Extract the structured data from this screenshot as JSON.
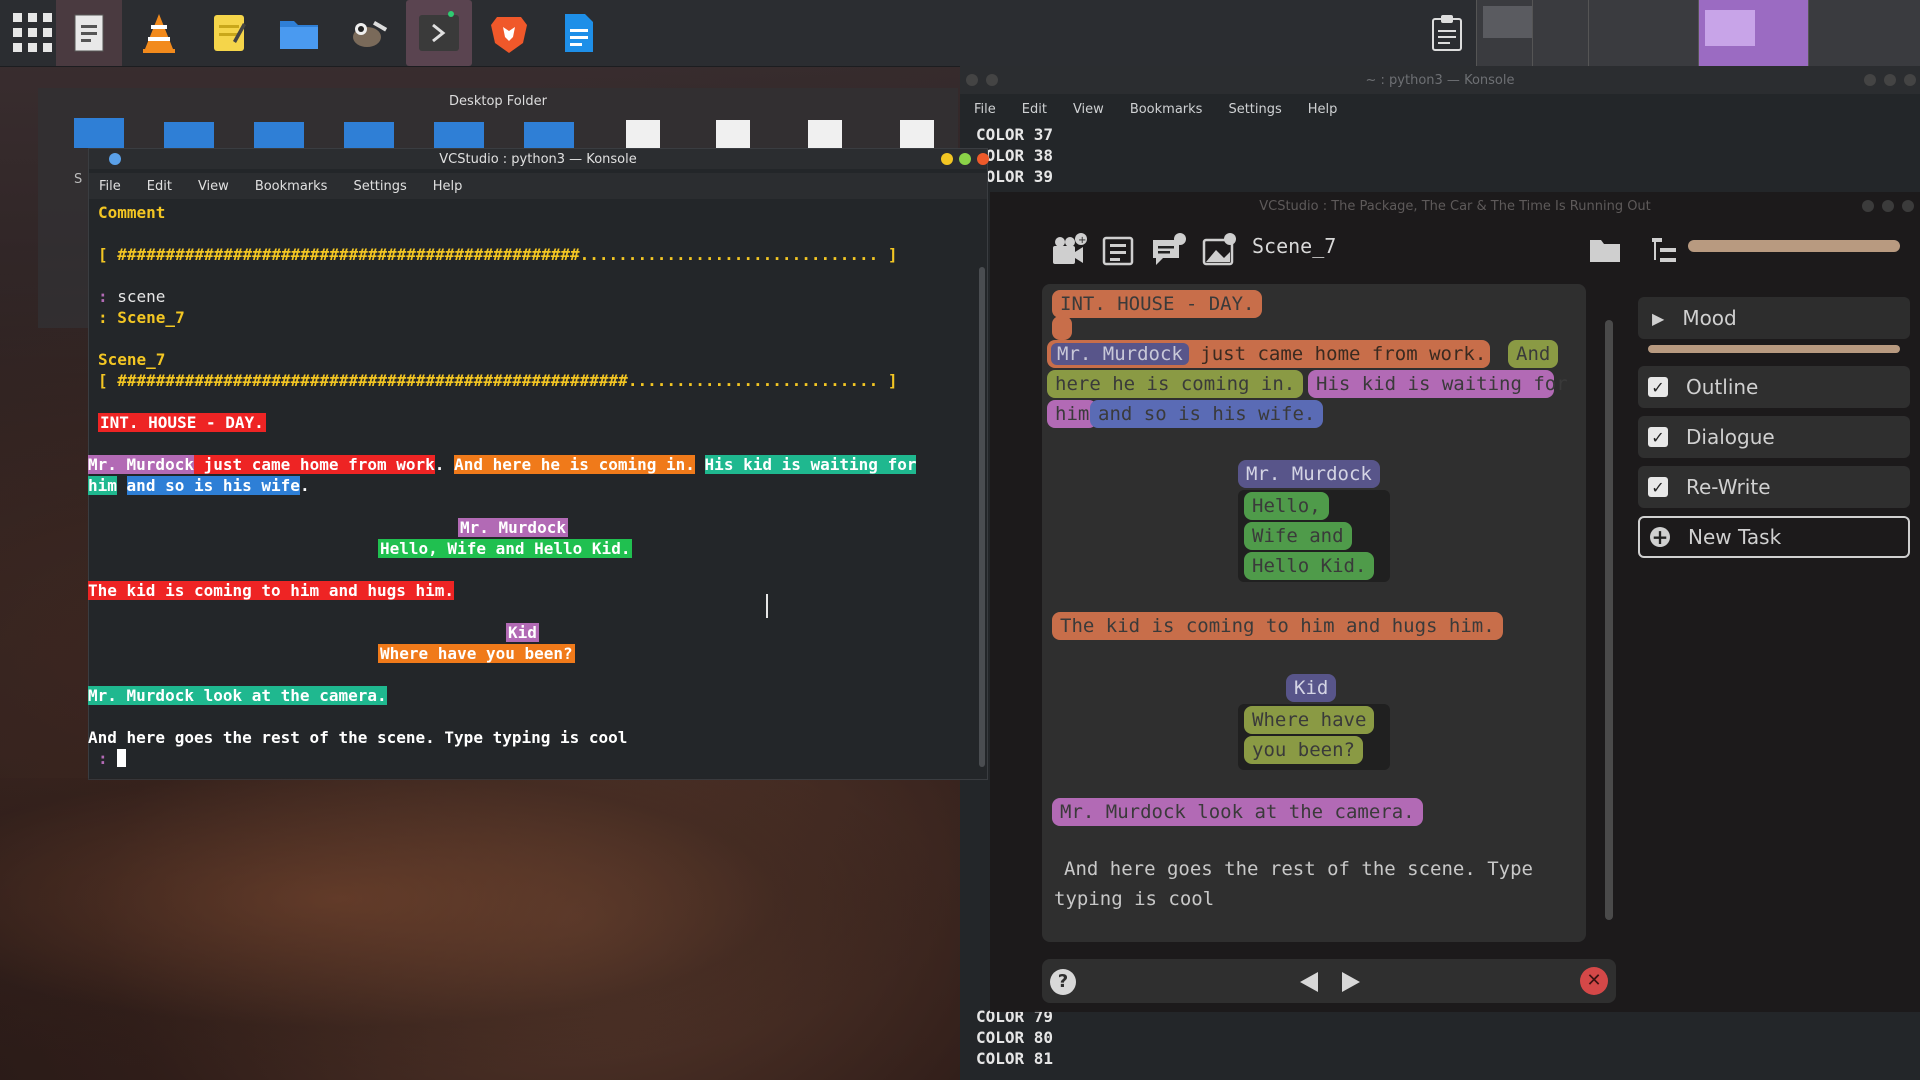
{
  "taskbar": {
    "launchers": [
      "app-grid-icon",
      "text-editor-icon",
      "vlc-icon",
      "notes-icon",
      "file-manager-icon",
      "gimp-icon",
      "terminal-icon",
      "brave-icon",
      "writer-icon"
    ]
  },
  "desktop_folder": {
    "title": "Desktop Folder",
    "side_label": "S"
  },
  "konsole_left": {
    "title": "VCStudio : python3 — Konsole",
    "menu": [
      "File",
      "Edit",
      "View",
      "Bookmarks",
      "Settings",
      "Help"
    ],
    "lines": {
      "comment": "Comment",
      "progress1_open": "[ ",
      "progress1_hashes": "################################################",
      "progress1_dots": "...............................",
      "progress1_close": " ]",
      "prompt1_colon": ": ",
      "prompt1_text": "scene",
      "prompt2": ": Scene_7",
      "scene_header": "Scene_7",
      "progress2_open": "[ ",
      "progress2_hashes": "#####################################################",
      "progress2_dots": "..........................",
      "progress2_close": " ]",
      "heading": "INT. HOUSE - DAY.",
      "para_a": "Mr. Murdock",
      "para_b": " just came home from work",
      "para_c": ".",
      "para_d": "And here he is coming in.",
      "para_e": "His kid is waiting for",
      "para_f": "him",
      "para_g": "and so is his wife",
      "para_h": ".",
      "char1": "Mr. Murdock",
      "dialog1": "Hello, Wife and Hello Kid.",
      "action2": "The kid is coming to him and hugs him.",
      "char2": "Kid",
      "dialog2": "Where have you been?",
      "action3": "Mr. Murdock look at the camera.",
      "action4": "And here goes the rest of the scene. Type typing is cool",
      "cursor_prompt": ":"
    }
  },
  "konsole_right": {
    "title": "~ : python3 — Konsole",
    "menu": [
      "File",
      "Edit",
      "View",
      "Bookmarks",
      "Settings",
      "Help"
    ],
    "top_lines": [
      "COLOR 37",
      "COLOR 38",
      "COLOR 39"
    ],
    "bottom_lines": [
      "COLOR 79",
      "COLOR 80",
      "COLOR 81"
    ]
  },
  "vcstudio": {
    "title": "VCStudio : The Package, The Car & The Time Is Running Out",
    "scene_name": "Scene_7",
    "script": {
      "heading": "INT. HOUSE - DAY.",
      "p1": "Mr. Murdock",
      "p2": "just came home from work.",
      "p3": "And",
      "p4": "here he is coming in.",
      "p5": "His kid is waiting for",
      "p6": "him",
      "p7": "and so is his wife.",
      "char1": "Mr. Murdock",
      "d1a": "Hello,",
      "d1b": "Wife and",
      "d1c": "Hello Kid.",
      "action2": "The kid is coming to him and hugs him.",
      "char2": "Kid",
      "d2a": "Where have",
      "d2b": "you been?",
      "action3": "Mr. Murdock look at the camera.",
      "action4a": "And here goes the rest of the scene. Type",
      "action4b": "typing is cool"
    },
    "checklist": {
      "mood": "Mood",
      "items": [
        "Outline",
        "Dialogue",
        "Re-Write"
      ],
      "new_task": "New Task"
    },
    "colors": {
      "heading": "#c86e4a",
      "character": "#58558a",
      "dialogue": "#4f9b4a",
      "action_green": "#8a9a44",
      "purple": "#b26ab5",
      "blue": "#5a6bb5",
      "pink": "#b26ab5"
    }
  }
}
